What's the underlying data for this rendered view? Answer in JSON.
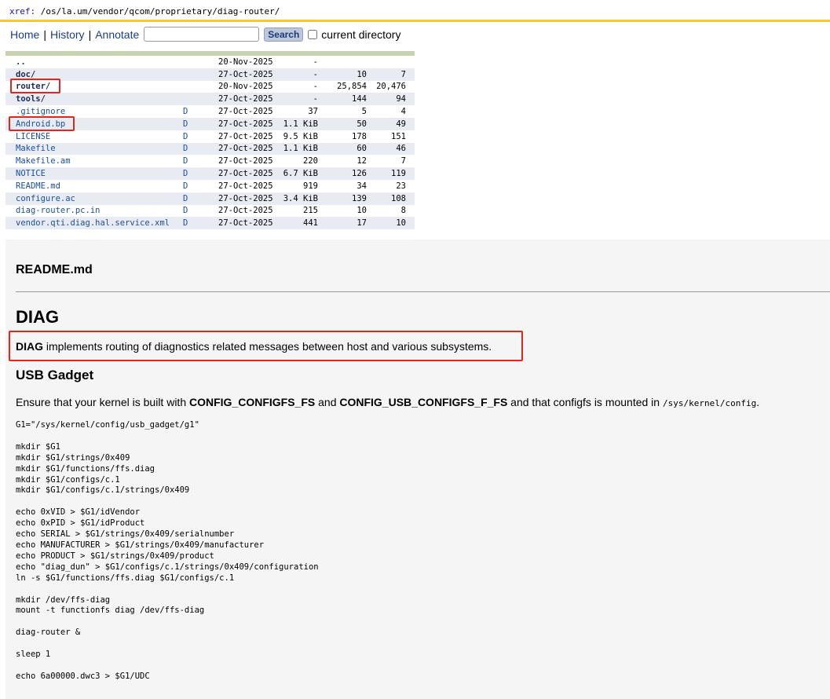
{
  "xref": {
    "label": "xref:",
    "path": "/os/la.um/vendor/qcom/proprietary/diag-router/"
  },
  "nav": {
    "home": "Home",
    "history": "History",
    "annotate": "Annotate",
    "separator": "|",
    "search_value": "",
    "search_button": "Search",
    "current_directory": "current directory"
  },
  "listing": [
    {
      "name": "..",
      "type": "dir",
      "d": "",
      "date": "20-Nov-2025",
      "size": "-",
      "lines": "",
      "loc": ""
    },
    {
      "name": "doc/",
      "type": "dir",
      "d": "",
      "date": "27-Oct-2025",
      "size": "-",
      "lines": "10",
      "loc": "7"
    },
    {
      "name": "router/",
      "type": "dir",
      "d": "",
      "date": "20-Nov-2025",
      "size": "-",
      "lines": "25,854",
      "loc": "20,476"
    },
    {
      "name": "tools/",
      "type": "dir",
      "d": "",
      "date": "27-Oct-2025",
      "size": "-",
      "lines": "144",
      "loc": "94"
    },
    {
      "name": ".gitignore",
      "type": "file",
      "d": "D",
      "date": "27-Oct-2025",
      "size": "37",
      "lines": "5",
      "loc": "4"
    },
    {
      "name": "Android.bp",
      "type": "file",
      "d": "D",
      "date": "27-Oct-2025",
      "size": "1.1 KiB",
      "lines": "50",
      "loc": "49"
    },
    {
      "name": "LICENSE",
      "type": "file",
      "d": "D",
      "date": "27-Oct-2025",
      "size": "9.5 KiB",
      "lines": "178",
      "loc": "151"
    },
    {
      "name": "Makefile",
      "type": "file",
      "d": "D",
      "date": "27-Oct-2025",
      "size": "1.1 KiB",
      "lines": "60",
      "loc": "46"
    },
    {
      "name": "Makefile.am",
      "type": "file",
      "d": "D",
      "date": "27-Oct-2025",
      "size": "220",
      "lines": "12",
      "loc": "7"
    },
    {
      "name": "NOTICE",
      "type": "file",
      "d": "D",
      "date": "27-Oct-2025",
      "size": "6.7 KiB",
      "lines": "126",
      "loc": "119"
    },
    {
      "name": "README.md",
      "type": "file",
      "d": "D",
      "date": "27-Oct-2025",
      "size": "919",
      "lines": "34",
      "loc": "23"
    },
    {
      "name": "configure.ac",
      "type": "file",
      "d": "D",
      "date": "27-Oct-2025",
      "size": "3.4 KiB",
      "lines": "139",
      "loc": "108"
    },
    {
      "name": "diag-router.pc.in",
      "type": "file",
      "d": "D",
      "date": "27-Oct-2025",
      "size": "215",
      "lines": "10",
      "loc": "8"
    },
    {
      "name": "vendor.qti.diag.hal.service.xml",
      "type": "file",
      "d": "D",
      "date": "27-Oct-2025",
      "size": "441",
      "lines": "17",
      "loc": "10"
    }
  ],
  "readme": {
    "filename": "README.md",
    "h1": "DIAG",
    "intro_bold": "DIAG",
    "intro_rest": " implements routing of diagnostics related messages between host and various subsystems.",
    "h2": "USB Gadget",
    "ensure_1": "Ensure that your kernel is built with ",
    "ensure_b1": "CONFIG_CONFIGFS_FS",
    "ensure_2": " and ",
    "ensure_b2": "CONFIG_USB_CONFIGFS_F_FS",
    "ensure_3": " and that configfs is mounted in ",
    "ensure_code": "/sys/kernel/config",
    "ensure_4": ".",
    "code": "G1=\"/sys/kernel/config/usb_gadget/g1\"\n\nmkdir $G1\nmkdir $G1/strings/0x409\nmkdir $G1/functions/ffs.diag\nmkdir $G1/configs/c.1\nmkdir $G1/configs/c.1/strings/0x409\n\necho 0xVID > $G1/idVendor\necho 0xPID > $G1/idProduct\necho SERIAL > $G1/strings/0x409/serialnumber\necho MANUFACTURER > $G1/strings/0x409/manufacturer\necho PRODUCT > $G1/strings/0x409/product\necho \"diag_dun\" > $G1/configs/c.1/strings/0x409/configuration\nln -s $G1/functions/ffs.diag $G1/configs/c.1\n\nmkdir /dev/ffs-diag\nmount -t functionfs diag /dev/ffs-diag\n\ndiag-router &\n\nsleep 1\n\necho 6a00000.dwc3 > $G1/UDC"
  }
}
